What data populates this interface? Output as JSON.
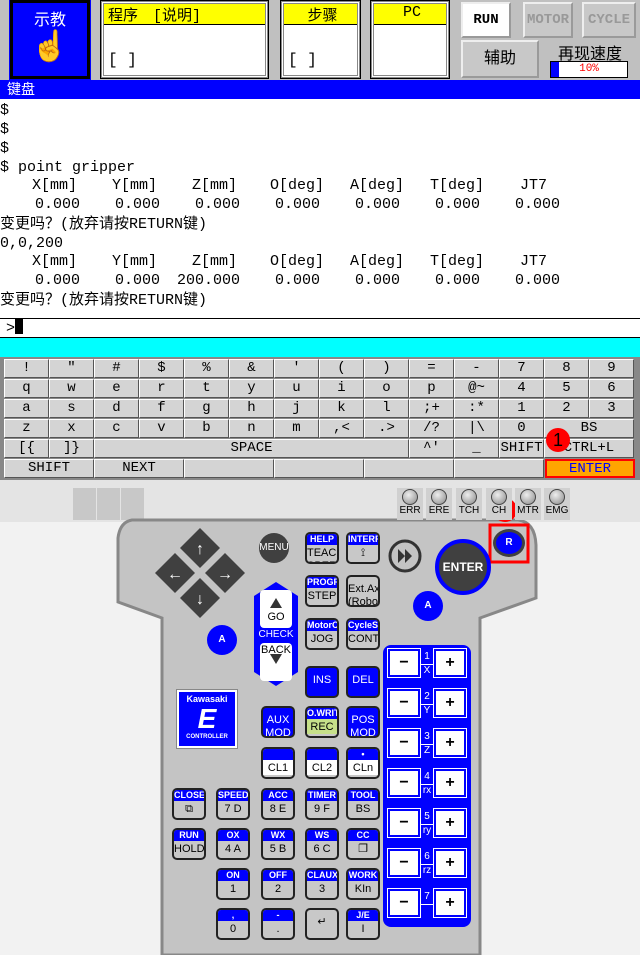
{
  "header": {
    "mode": "示教",
    "program_label": "程序　[说明]",
    "program_value": "[                    ]",
    "step_label": "步骤",
    "step_value": "[        ]",
    "pc_label": "PC",
    "run": "RUN",
    "motor": "MOTOR",
    "cycle": "CYCLE",
    "aux": "辅助",
    "speed_label": "再现速度",
    "speed_value": "10%",
    "speed_percent": 10
  },
  "title_bar": "键盘",
  "terminal": {
    "lines": [
      "$",
      "$",
      "$",
      "$ point gripper"
    ],
    "table1": {
      "headers": [
        "X[mm]",
        "Y[mm]",
        "Z[mm]",
        "O[deg]",
        "A[deg]",
        "T[deg]",
        "JT7"
      ],
      "values": [
        "0.000",
        "0.000",
        "0.000",
        "0.000",
        "0.000",
        "0.000",
        "0.000"
      ]
    },
    "question1": "变更吗？(放弃请按RETURN键)",
    "input_echo": "0,0,200",
    "table2": {
      "headers": [
        "X[mm]",
        "Y[mm]",
        "Z[mm]",
        "O[deg]",
        "A[deg]",
        "T[deg]",
        "JT7"
      ],
      "values": [
        "0.000",
        "0.000",
        "200.000",
        "0.000",
        "0.000",
        "0.000",
        "0.000"
      ]
    },
    "question2": "变更吗？(放弃请按RETURN键)",
    "prompt": ">"
  },
  "keyboard": {
    "rows": [
      [
        "!",
        "\"",
        "#",
        "$",
        "%",
        "&",
        "'",
        "(",
        ")",
        "=",
        "-",
        "7",
        "8",
        "9"
      ],
      [
        "q",
        "w",
        "e",
        "r",
        "t",
        "y",
        "u",
        "i",
        "o",
        "p",
        "@~",
        "4",
        "5",
        "6"
      ],
      [
        "a",
        "s",
        "d",
        "f",
        "g",
        "h",
        "j",
        "k",
        "l",
        ";+",
        ":*",
        "1",
        "2",
        "3"
      ],
      [
        "z",
        "x",
        "c",
        "v",
        "b",
        "n",
        "m",
        ",<",
        ".>",
        "/?",
        "|\\",
        "0",
        "BS"
      ],
      [
        "[{",
        "]}",
        "SPACE",
        "^'",
        "_",
        "SHIFT",
        "CTRL+L"
      ],
      [
        "SHIFT",
        "NEXT",
        "",
        "",
        "",
        "",
        "ENTER"
      ]
    ]
  },
  "annotations": {
    "step1": "1",
    "step2": "2",
    "color": "#ff0000"
  },
  "leds": [
    "ERR",
    "ERE",
    "TCH",
    "CH",
    "MTR",
    "EMG"
  ],
  "pendant": {
    "menu": "MENU",
    "go": "GO",
    "check": "CHECK",
    "back": "BACK",
    "a_left": "A",
    "a_right": "A",
    "enter": "ENTER",
    "r": "R",
    "logo": {
      "brand": "Kawasaki",
      "letter": "E",
      "sub": "CONTROLLER"
    },
    "keys": [
      {
        "h": "HELP",
        "b": "TEACH SPEED",
        "s": "gray"
      },
      {
        "h": "INTERP",
        "b": "⟟",
        "s": "gray"
      },
      {
        "h": "PROGRAM",
        "b": "STEP",
        "s": "gray"
      },
      {
        "h": "",
        "b": "Ext.Axis (Robot)",
        "s": "gray"
      },
      {
        "h": "MotorON",
        "b": "JOG",
        "s": "gray"
      },
      {
        "h": "CycleStart",
        "b": "CONT",
        "s": "gray"
      },
      {
        "h": "",
        "b": "INS",
        "s": "blue"
      },
      {
        "h": "",
        "b": "DEL",
        "s": "blue"
      },
      {
        "h": "",
        "b": "AUX MOD",
        "s": "blue"
      },
      {
        "h": "O.WRITE",
        "b": "REC",
        "s": "green"
      },
      {
        "h": "",
        "b": "POS MOD",
        "s": "blue"
      },
      {
        "h": " ",
        "b": "CL1",
        "s": "white"
      },
      {
        "h": " ",
        "b": "CL2",
        "s": "white"
      },
      {
        "h": "•",
        "b": "CLn",
        "s": "white"
      },
      {
        "h": "CLOSE",
        "b": "⧉",
        "s": "gray"
      },
      {
        "h": "SPEED",
        "b": "7 D",
        "s": "gray"
      },
      {
        "h": "ACC",
        "b": "8 E",
        "s": "gray"
      },
      {
        "h": "TIMER",
        "b": "9 F",
        "s": "gray"
      },
      {
        "h": "TOOL",
        "b": "BS",
        "s": "gray"
      },
      {
        "h": "RUN",
        "b": "HOLD",
        "s": "gray"
      },
      {
        "h": "OX",
        "b": "4 A",
        "s": "gray"
      },
      {
        "h": "WX",
        "b": "5 B",
        "s": "gray"
      },
      {
        "h": "WS",
        "b": "6 C",
        "s": "gray"
      },
      {
        "h": "CC",
        "b": "❐",
        "s": "gray"
      },
      {
        "h": "ON",
        "b": "1",
        "s": "gray"
      },
      {
        "h": "OFF",
        "b": "2",
        "s": "gray"
      },
      {
        "h": "CLAUX",
        "b": "3",
        "s": "gray"
      },
      {
        "h": "WORK",
        "b": "KIn",
        "s": "gray"
      },
      {
        "h": ",",
        "b": "0",
        "s": "gray"
      },
      {
        "h": "-",
        "b": ".",
        "s": "gray"
      },
      {
        "h": "",
        "b": "↵",
        "s": "gray"
      },
      {
        "h": "J/E",
        "b": "I",
        "s": "gray"
      }
    ],
    "jog": [
      {
        "n": "1",
        "a": "X"
      },
      {
        "n": "2",
        "a": "Y"
      },
      {
        "n": "3",
        "a": "Z"
      },
      {
        "n": "4",
        "a": "rx"
      },
      {
        "n": "5",
        "a": "ry"
      },
      {
        "n": "6",
        "a": "rz"
      },
      {
        "n": "7",
        "a": ""
      }
    ],
    "minus": "−",
    "plus": "+"
  },
  "colors": {
    "accent": "#0000ff",
    "highlight": "#ffff00",
    "terminal_bar": "#00ffff",
    "enter_key": "#ffa500",
    "annotation": "#ff0000"
  }
}
